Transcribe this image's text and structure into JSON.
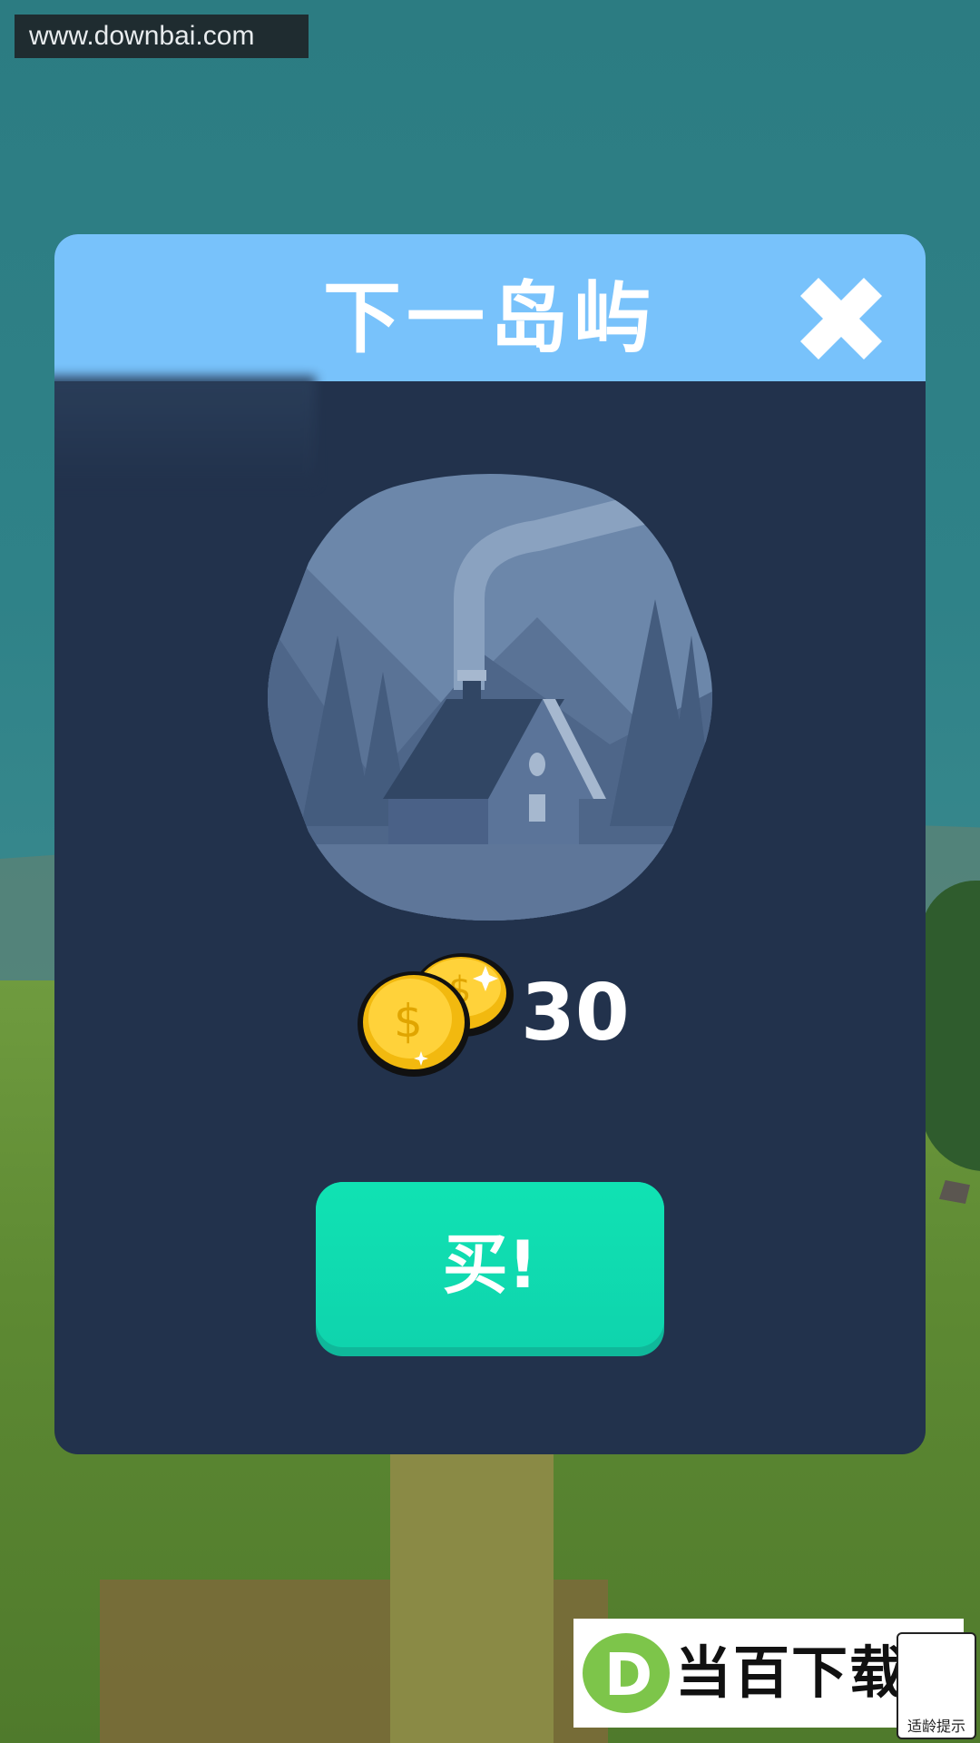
{
  "watermark_top": {
    "text": "www.downbai.com"
  },
  "dialog": {
    "title": "下一岛屿",
    "close_icon": "close-x-icon",
    "preview_image": "cabin-in-forest",
    "price": {
      "icon": "gold-coins-icon",
      "value": "30"
    },
    "buy_button": {
      "label": "买!"
    }
  },
  "watermark_bottom": {
    "brand": "当百下载",
    "logo_letter": "D",
    "age_badge": "适龄提示"
  },
  "colors": {
    "header": "#78c2fb",
    "dialog_bg": "#22324c",
    "buy_button": "#10e2b3",
    "coin": "#f5c518"
  }
}
